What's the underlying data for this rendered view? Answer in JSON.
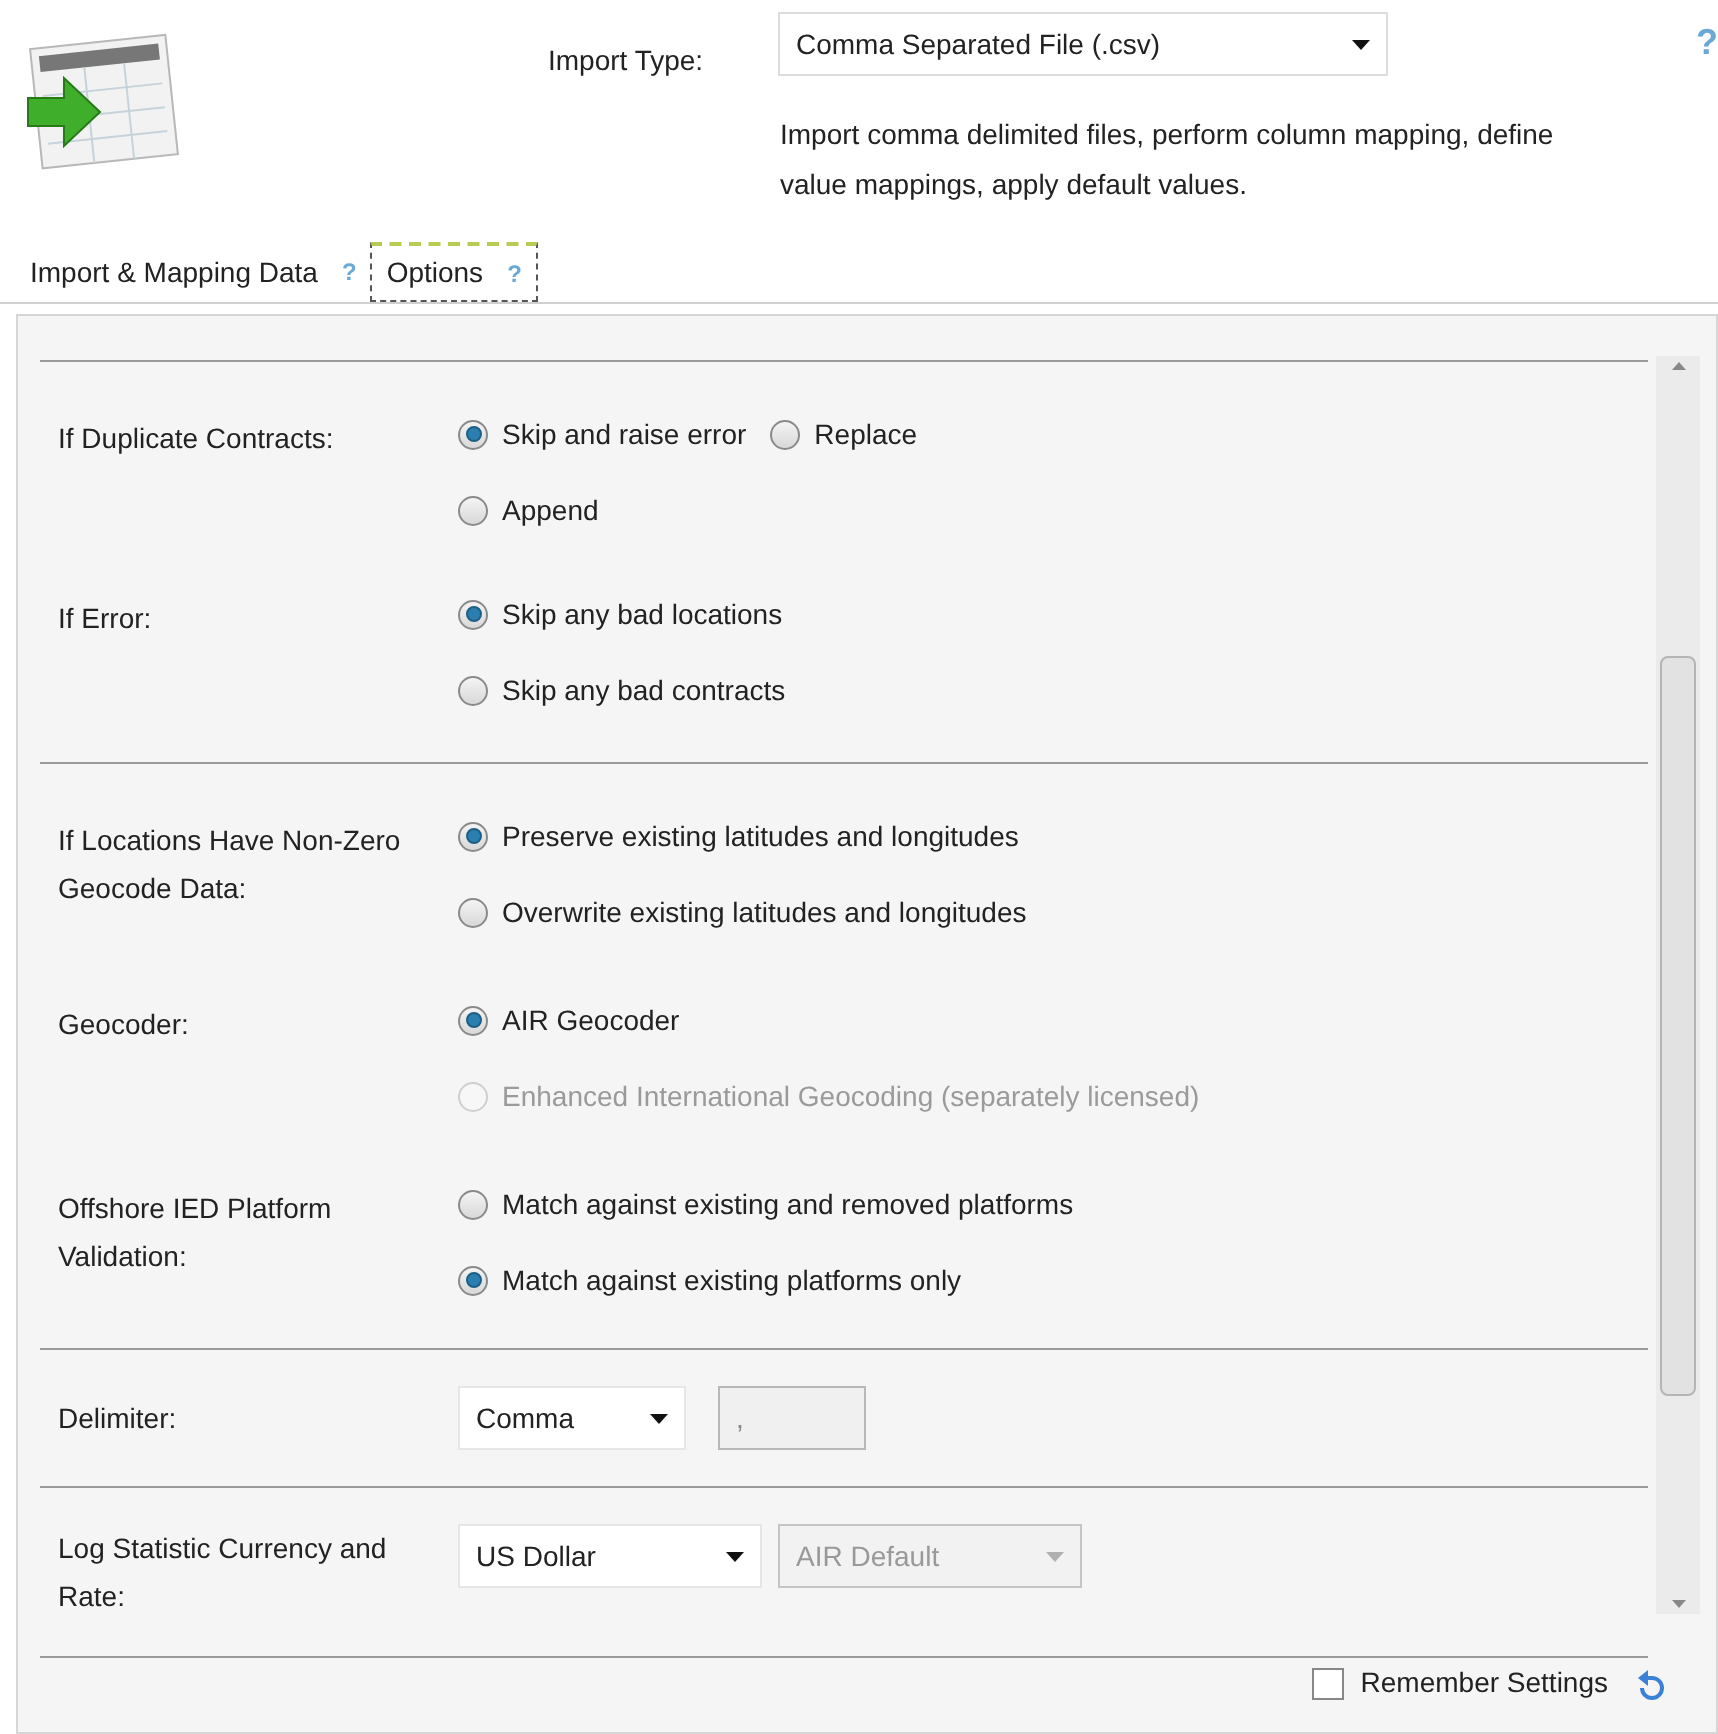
{
  "header": {
    "import_type_label": "Import Type:",
    "import_type_value": "Comma Separated File (.csv)",
    "description": "Import comma delimited files, perform column mapping, define value mappings, apply default values.",
    "help": "?"
  },
  "tabs": [
    {
      "label": "Import & Mapping Data",
      "help": "?",
      "selected": false
    },
    {
      "label": "Options",
      "help": "?",
      "selected": true
    }
  ],
  "sections": [
    {
      "settings": [
        {
          "kind": "radio_flow",
          "label": "If Duplicate Contracts:",
          "options": [
            {
              "label": "Skip and raise error",
              "selected": true,
              "disabled": false
            },
            {
              "label": "Replace",
              "selected": false,
              "disabled": false
            },
            {
              "label": "Append",
              "selected": false,
              "disabled": false
            }
          ]
        },
        {
          "kind": "radio",
          "label": "If Error:",
          "options": [
            {
              "label": "Skip any bad locations",
              "selected": true,
              "disabled": false
            },
            {
              "label": "Skip any bad contracts",
              "selected": false,
              "disabled": false
            }
          ]
        }
      ]
    },
    {
      "settings": [
        {
          "kind": "radio",
          "label": "If Locations Have Non-Zero Geocode Data:",
          "options": [
            {
              "label": "Preserve existing latitudes and longitudes",
              "selected": true,
              "disabled": false
            },
            {
              "label": "Overwrite existing latitudes and longitudes",
              "selected": false,
              "disabled": false
            }
          ]
        },
        {
          "kind": "radio",
          "label": "Geocoder:",
          "options": [
            {
              "label": "AIR Geocoder",
              "selected": true,
              "disabled": false
            },
            {
              "label": "Enhanced International Geocoding (separately licensed)",
              "selected": false,
              "disabled": true
            }
          ]
        },
        {
          "kind": "radio",
          "label": "Offshore IED Platform Validation:",
          "options": [
            {
              "label": "Match against existing and removed platforms",
              "selected": false,
              "disabled": false
            },
            {
              "label": "Match against existing platforms only",
              "selected": true,
              "disabled": false
            }
          ]
        }
      ]
    },
    {
      "settings": [
        {
          "kind": "delimiter",
          "label": "Delimiter:",
          "select": "Comma",
          "value": ","
        }
      ]
    },
    {
      "settings": [
        {
          "kind": "currency",
          "label": "Log Statistic Currency and Rate:",
          "select": "US Dollar",
          "rate": "AIR Default"
        }
      ]
    }
  ],
  "footer": {
    "remember_label": "Remember Settings",
    "remember_checked": false
  }
}
